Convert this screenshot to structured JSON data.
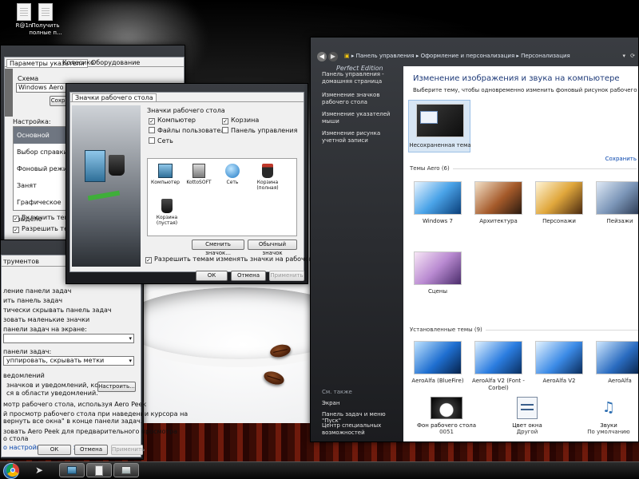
{
  "desktop": {
    "icons": [
      {
        "label": "R@1n"
      },
      {
        "label": "Получить полные п..."
      }
    ]
  },
  "mouse_props": {
    "tabs": [
      "Параметры указателя",
      "Колесико",
      "Оборудование"
    ],
    "scheme_label": "Схема",
    "scheme_value": "Windows Aero (систе",
    "save_btn": "Сохран",
    "setting_label": "Настройка:",
    "list": [
      "Основной режим",
      "Выбор справки",
      "Фоновый режим",
      "Занят",
      "Графическое выделе"
    ],
    "check_shadow": "Включить тень указ",
    "check_themes": "Разрешить темам из"
  },
  "taskbar_props": {
    "tab": "трументов",
    "section_taskbar": "ление панели задач",
    "opt1": "ить панель задач",
    "opt2": "тически скрывать панель задач",
    "opt3": "зовать маленькие значки",
    "position_label": "панели задач на экране:",
    "buttons_label": "панели задач:",
    "buttons_value": "уппировать, скрывать метки",
    "notify_title": "ведомлений",
    "notify_text_1": "значков и уведомлений, которые",
    "notify_text_2": "ся в области уведомлений.",
    "notify_btn": "Настроить...",
    "peek_label": "мотр рабочего стола, используя Aero Peek",
    "peek_text_1": "й просмотр рабочего стола при наведении курсора на",
    "peek_text_2": "вернуть все окна\" в конце панели задач.",
    "peek_text_3": "зовать Aero Peek для предварительного просмотра",
    "peek_text_4": "о стола",
    "link": "о настройки панели задач?",
    "ok": "ОК",
    "cancel": "Отмена",
    "apply": "Применить"
  },
  "icons_dlg": {
    "tab": "Значки рабочего стола",
    "group_title": "Значки рабочего стола",
    "checks": [
      {
        "label": "Компьютер",
        "checked": true
      },
      {
        "label": "Корзина",
        "checked": true
      },
      {
        "label": "Файлы пользователя",
        "checked": false
      },
      {
        "label": "Панель управления",
        "checked": false
      },
      {
        "label": "Сеть",
        "checked": false
      }
    ],
    "icons": [
      {
        "label": "Компьютер",
        "icon": "computer-icon"
      },
      {
        "label": "KottoSOFT",
        "icon": "user-folder-icon"
      },
      {
        "label": "Сеть",
        "icon": "network-icon"
      },
      {
        "label": "Корзина (полная)",
        "icon": "recycle-bin-full-icon"
      },
      {
        "label": "Корзина (пустая)",
        "icon": "recycle-bin-empty-icon"
      }
    ],
    "change_icon": "Сменить значок...",
    "default_icon": "Обычный значок",
    "allow_themes": "Разрешить темам изменять значки на рабочем столе",
    "ok": "ОК",
    "cancel": "Отмена",
    "apply": "Применить"
  },
  "control_panel": {
    "breadcrumbs": [
      "Панель управления",
      "Оформление и персонализация",
      "Персонализация"
    ],
    "watermark": "Perfect Edition",
    "sidebar_links": [
      "Панель управления - домашняя страница",
      "Изменение значков рабочего стола",
      "Изменение указателей мыши",
      "Изменение рисунка учетной записи"
    ],
    "see_also_title": "См. также",
    "see_also": [
      "Экран",
      "Панель задач и меню \"Пуск\"",
      "Центр специальных возможностей"
    ],
    "title": "Изменение изображения и звука на компьютере",
    "subtitle": "Выберите тему, чтобы одновременно изменить фоновый рисунок рабочего стола, цвет окна",
    "unsaved_theme": "Несохраненная тема",
    "save_link": "Сохранить",
    "aero_title": "Темы Aero (6)",
    "aero_themes": [
      "Windows 7",
      "Архитектура",
      "Персонажи",
      "Пейзажи",
      "Сцены"
    ],
    "installed_title": "Установленные темы (9)",
    "installed_themes": [
      "AeroAlfa (BlueFire)",
      "AeroAlfa V2 (Font - Corbel)",
      "AeroAlfa V2",
      "AeroAlfa"
    ],
    "bottom": [
      {
        "title": "Фон рабочего стола",
        "value": "0051"
      },
      {
        "title": "Цвет окна",
        "value": "Другой"
      },
      {
        "title": "Звуки",
        "value": "По умолчанию"
      }
    ]
  },
  "taskbar": {
    "items": [
      "start-orb-icon",
      "chrome-icon",
      "cursor-icon",
      "computer-icon",
      "file-icon",
      "control-panel-icon"
    ]
  }
}
